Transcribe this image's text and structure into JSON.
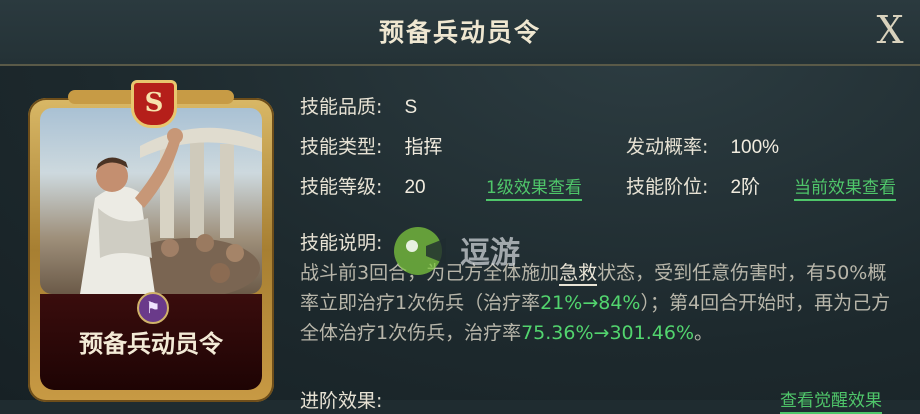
{
  "dialog": {
    "title": "预备兵动员令",
    "close_label": "X"
  },
  "card": {
    "grade": "S",
    "name": "预备兵动员令",
    "emblem": "⚑"
  },
  "info": {
    "quality_label": "技能品质:",
    "quality_value": "S",
    "type_label": "技能类型:",
    "type_value": "指挥",
    "prob_label": "发动概率:",
    "prob_value": "100%",
    "level_label": "技能等级:",
    "level_value": "20",
    "level_link": "1级效果查看",
    "stage_label": "技能阶位:",
    "stage_value": "2阶",
    "stage_link": "当前效果查看"
  },
  "description": {
    "label": "技能说明:",
    "p1": "战斗前3回合，为己方全体施加",
    "keyword": "急救",
    "p2": "状态，受到任意伤害时，有50%概率立即治疗1次伤兵（治疗率",
    "rate1": "21%→84%",
    "p3": "）；第4回合开始时，再为己方全体治疗1次伤兵，治疗率",
    "rate2": "75.36%→301.46%",
    "p4": "。"
  },
  "advance": {
    "label": "进阶效果:",
    "link": "查看觉醒效果"
  },
  "watermark": {
    "text": "逗游"
  },
  "colors": {
    "accent_green": "#4fc66a",
    "card_red": "#b51f1a",
    "gold": "#d9b866"
  }
}
